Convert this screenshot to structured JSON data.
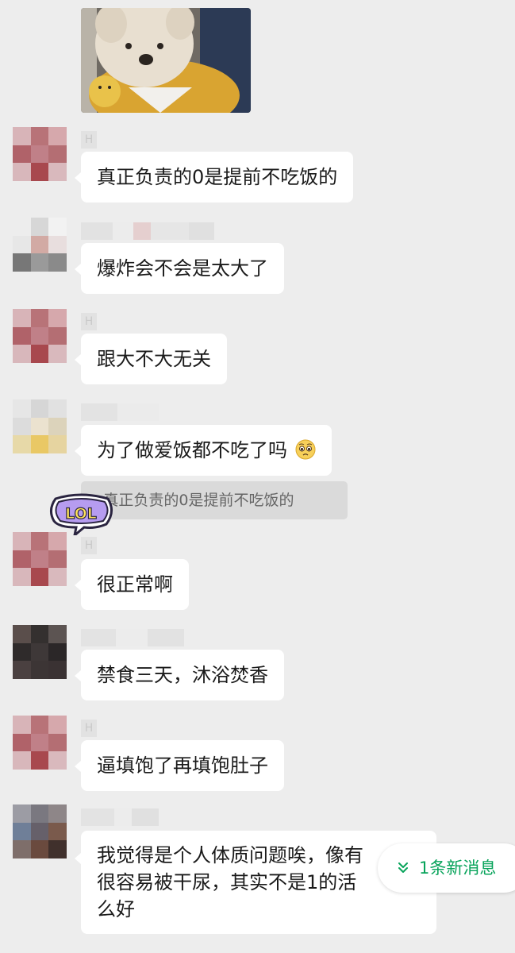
{
  "colors": {
    "background": "#ededed",
    "bubble": "#ffffff",
    "quote_background": "#dadada",
    "accent_green": "#07a35a"
  },
  "top_image": {
    "description_icon": "dog-sticker-image"
  },
  "messages": [
    {
      "text": "真正负责的0是提前不吃饭的"
    },
    {
      "text": "爆炸会不会是太大了"
    },
    {
      "text": "跟大不大无关"
    },
    {
      "text": "为了做爱饭都不吃了吗",
      "emoji": "pleading-face-icon"
    },
    {
      "text": "很正常啊"
    },
    {
      "text": "禁食三天，沐浴焚香"
    },
    {
      "text": "逼填饱了再填饱肚子"
    },
    {
      "lines": [
        "我觉得是个人体质问题唉，像有",
        "很容易被干尿，其实不是1的活",
        "么好"
      ]
    }
  ],
  "quote": {
    "text": "真正负责的0是提前不吃饭的"
  },
  "sticker": {
    "label": "LOL"
  },
  "new_messages": {
    "label": "1条新消息",
    "icon": "chevron-double-down-icon"
  },
  "sender_initial": "H"
}
